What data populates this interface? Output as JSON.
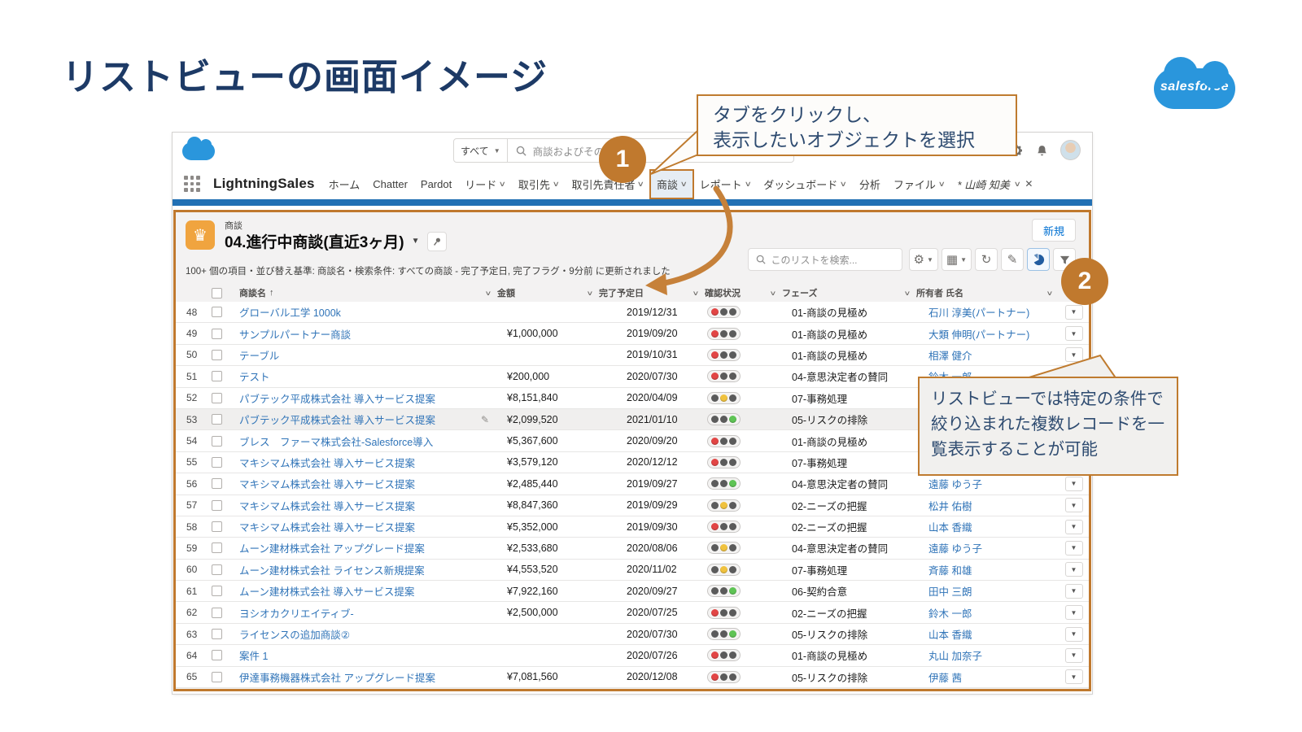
{
  "slide": {
    "title": "リストビューの画面イメージ",
    "brand": "salesforce"
  },
  "callout1": {
    "number": "1",
    "text": "タブをクリックし、\n表示したいオブジェクトを選択"
  },
  "callout2": {
    "number": "2",
    "text": "リストビューでは特定の条件で絞り込まれた複数レコードを一覧表示することが可能"
  },
  "header": {
    "search_scope": "すべて",
    "search_placeholder": "商談およびその他"
  },
  "nav": {
    "app_name": "LightningSales",
    "tabs": [
      {
        "label": "ホーム"
      },
      {
        "label": "Chatter"
      },
      {
        "label": "Pardot"
      },
      {
        "label": "リード",
        "chevron": true
      },
      {
        "label": "取引先",
        "chevron": true
      },
      {
        "label": "取引先責任者",
        "chevron": true
      },
      {
        "label": "商談",
        "chevron": true,
        "active": true
      },
      {
        "label": "レポート",
        "chevron": true
      },
      {
        "label": "ダッシュボード",
        "chevron": true
      },
      {
        "label": "分析"
      },
      {
        "label": "ファイル",
        "chevron": true
      }
    ],
    "temp_tab": {
      "label": "* 山崎 知美"
    }
  },
  "listview": {
    "object_label": "商談",
    "view_title": "04.進行中商談(直近3ヶ月)",
    "meta": "100+ 個の項目・並び替え基準: 商談名・検索条件: すべての商談 - 完了予定日, 完了フラグ・9分前 に更新されました",
    "new_button": "新規",
    "list_search_placeholder": "このリストを検索...",
    "columns": [
      "商談名",
      "金額",
      "完了予定日",
      "確認状況",
      "フェーズ",
      "所有者 氏名"
    ],
    "rows": [
      {
        "num": "48",
        "name": "グローバル工学 1000k",
        "amount": "",
        "date": "2019/12/31",
        "status": "red",
        "phase": "01-商談の見極め",
        "owner": "石川 淳美(パートナー)"
      },
      {
        "num": "49",
        "name": "サンプルパートナー商談",
        "amount": "¥1,000,000",
        "date": "2019/09/20",
        "status": "red",
        "phase": "01-商談の見極め",
        "owner": "大類 伸明(パートナー)"
      },
      {
        "num": "50",
        "name": "テーブル",
        "amount": "",
        "date": "2019/10/31",
        "status": "red",
        "phase": "01-商談の見極め",
        "owner": "相澤 健介"
      },
      {
        "num": "51",
        "name": "テスト",
        "amount": "¥200,000",
        "date": "2020/07/30",
        "status": "red",
        "phase": "04-意思決定者の賛同",
        "owner": "鈴木 一郎"
      },
      {
        "num": "52",
        "name": "パブテック平成株式会社 導入サービス提案",
        "amount": "¥8,151,840",
        "date": "2020/04/09",
        "status": "yellow",
        "phase": "07-事務処理",
        "owner": ""
      },
      {
        "num": "53",
        "name": "パブテック平成株式会社 導入サービス提案",
        "amount": "¥2,099,520",
        "date": "2021/01/10",
        "status": "green",
        "phase": "05-リスクの排除",
        "owner": "",
        "edit": true,
        "highlight": true
      },
      {
        "num": "54",
        "name": "ブレス　ファーマ株式会社-Salesforce導入",
        "amount": "¥5,367,600",
        "date": "2020/09/20",
        "status": "red",
        "phase": "01-商談の見極め",
        "owner": ""
      },
      {
        "num": "55",
        "name": "マキシマム株式会社 導入サービス提案",
        "amount": "¥3,579,120",
        "date": "2020/12/12",
        "status": "red",
        "phase": "07-事務処理",
        "owner": ""
      },
      {
        "num": "56",
        "name": "マキシマム株式会社 導入サービス提案",
        "amount": "¥2,485,440",
        "date": "2019/09/27",
        "status": "green",
        "phase": "04-意思決定者の賛同",
        "owner": "遠藤 ゆう子"
      },
      {
        "num": "57",
        "name": "マキシマム株式会社 導入サービス提案",
        "amount": "¥8,847,360",
        "date": "2019/09/29",
        "status": "yellow",
        "phase": "02-ニーズの把握",
        "owner": "松井 佑樹"
      },
      {
        "num": "58",
        "name": "マキシマム株式会社 導入サービス提案",
        "amount": "¥5,352,000",
        "date": "2019/09/30",
        "status": "red",
        "phase": "02-ニーズの把握",
        "owner": "山本 香織"
      },
      {
        "num": "59",
        "name": "ムーン建材株式会社 アップグレード提案",
        "amount": "¥2,533,680",
        "date": "2020/08/06",
        "status": "yellow",
        "phase": "04-意思決定者の賛同",
        "owner": "遠藤 ゆう子"
      },
      {
        "num": "60",
        "name": "ムーン建材株式会社 ライセンス新規提案",
        "amount": "¥4,553,520",
        "date": "2020/11/02",
        "status": "yellow",
        "phase": "07-事務処理",
        "owner": "斉藤 和雄"
      },
      {
        "num": "61",
        "name": "ムーン建材株式会社 導入サービス提案",
        "amount": "¥7,922,160",
        "date": "2020/09/27",
        "status": "green",
        "phase": "06-契約合意",
        "owner": "田中 三朗"
      },
      {
        "num": "62",
        "name": "ヨシオカクリエイティブ-",
        "amount": "¥2,500,000",
        "date": "2020/07/25",
        "status": "red",
        "phase": "02-ニーズの把握",
        "owner": "鈴木 一郎"
      },
      {
        "num": "63",
        "name": "ライセンスの追加商談②",
        "amount": "",
        "date": "2020/07/30",
        "status": "green",
        "phase": "05-リスクの排除",
        "owner": "山本 香織"
      },
      {
        "num": "64",
        "name": "案件 1",
        "amount": "",
        "date": "2020/07/26",
        "status": "red",
        "phase": "01-商談の見極め",
        "owner": "丸山 加奈子"
      },
      {
        "num": "65",
        "name": "伊達事務機器株式会社 アップグレード提案",
        "amount": "¥7,081,560",
        "date": "2020/12/08",
        "status": "red",
        "phase": "05-リスクの排除",
        "owner": "伊藤 茜"
      }
    ]
  }
}
